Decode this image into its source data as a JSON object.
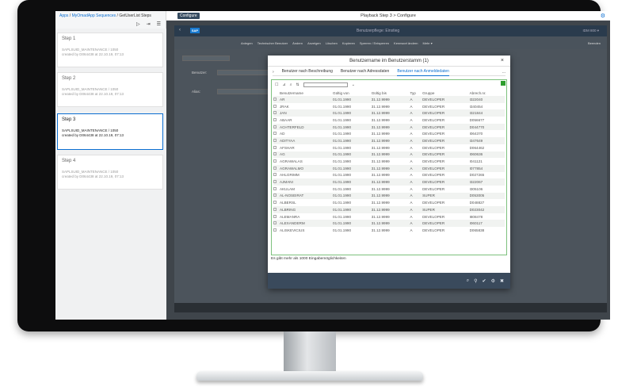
{
  "left": {
    "breadcrumb": {
      "apps": "Apps",
      "sequences": "MyOmadApp Sequences",
      "current": "GetUserList Steps"
    },
    "icons": [
      "play-icon",
      "step-forward-icon",
      "list-icon"
    ],
    "steps": [
      {
        "title": "Step 1",
        "line1": "SAPLSUID_MAINTENANCE / 1050",
        "line2": "created by D064438 at 22.10.19, 07:13"
      },
      {
        "title": "Step 2",
        "line1": "SAPLSUID_MAINTENANCE / 1050",
        "line2": "created by D064438 at 22.10.19, 07:13"
      },
      {
        "title": "Step 3",
        "line1": "SAPLSUID_MAINTENANCE / 1050",
        "line2": "created by D064438 at 22.10.19, 07:13"
      },
      {
        "title": "Step 4",
        "line1": "SAPLSUID_MAINTENANCE / 1050",
        "line2": "created by D064438 at 22.10.19, 07:13"
      }
    ]
  },
  "topbar": {
    "configure": "Configure",
    "title": "Playback Step 3 > Configure"
  },
  "sap": {
    "logo": "SAP",
    "header_title": "Benutzerpflege: Einstieg",
    "header_right": "IDM 800 ▾",
    "toolbar": [
      "Anlegen",
      "Technischer Benutzer",
      "Ändern",
      "Anzeigen",
      "Löschen",
      "Kopieren",
      "Sperren / Entsperren",
      "Kennwort ändern",
      "Mehr ▾"
    ],
    "toolbar_right": "Beenden",
    "fields": [
      "Benutzer:",
      "Alias:"
    ]
  },
  "dialog": {
    "title": "Benutzername im Benutzerstamm (1)",
    "tabs": [
      "Benutzer nach Beschreibung",
      "Benutzer nach Adressdaten",
      "Benutzer nach Anmeldedaten"
    ],
    "more": "...",
    "columns": [
      "Benutzername",
      "Gültig von",
      "Gültig bis",
      "Typ",
      "Gruppe",
      "Abrech.nr."
    ],
    "rows": [
      [
        "AR",
        "01.01.1990",
        "31.12.9999",
        "A",
        "DEVELOPER",
        "I322040"
      ],
      [
        "JRAK",
        "01.01.1990",
        "31.12.9999",
        "A",
        "DEVELOPER",
        "I340454"
      ],
      [
        "JAN",
        "01.01.1990",
        "31.12.9999",
        "A",
        "DEVELOPER",
        "I321844"
      ],
      [
        "ABAAR",
        "01.01.1990",
        "31.12.9999",
        "A",
        "DEVELOPER",
        "D056677"
      ],
      [
        "ACHTERFELD",
        "01.01.1990",
        "31.12.9999",
        "A",
        "DEVELOPER",
        "D044770"
      ],
      [
        "AD",
        "01.01.1990",
        "31.12.9999",
        "A",
        "DEVELOPER",
        "I064370"
      ],
      [
        "ADITYAA",
        "01.01.1990",
        "31.12.9999",
        "A",
        "DEVELOPER",
        "I347649"
      ],
      [
        "AFSHAR",
        "01.01.1990",
        "31.12.9999",
        "A",
        "DEVELOPER",
        "D064462"
      ],
      [
        "AG",
        "01.01.1990",
        "31.12.9999",
        "A",
        "DEVELOPER",
        "I060636"
      ],
      [
        "AGRAWALAS",
        "01.01.1990",
        "31.12.9999",
        "A",
        "DEVELOPER",
        "I041121"
      ],
      [
        "AGRAWALMO",
        "01.01.1990",
        "31.12.9999",
        "A",
        "DEVELOPER",
        "I077854"
      ],
      [
        "AHLGRIMM",
        "01.01.1990",
        "31.12.9999",
        "A",
        "DEVELOPER",
        "D027265"
      ],
      [
        "AJMANI",
        "01.01.1990",
        "31.12.9999",
        "A",
        "DEVELOPER",
        "I322067"
      ],
      [
        "AKULAM",
        "01.01.1990",
        "31.12.9999",
        "A",
        "DEVELOPER",
        "I305106"
      ],
      [
        "AL-NOSEIRAT",
        "01.01.1990",
        "31.12.9999",
        "A",
        "SUPER",
        "D053005"
      ],
      [
        "ALBERSL",
        "01.01.1990",
        "31.12.9999",
        "A",
        "DEVELOPER",
        "D048827"
      ],
      [
        "ALBRING",
        "01.01.1990",
        "31.12.9999",
        "A",
        "SUPER",
        "D023042"
      ],
      [
        "ALEMANRA",
        "01.01.1990",
        "31.12.9999",
        "A",
        "DEVELOPER",
        "I808478"
      ],
      [
        "ALEXANDERM",
        "01.01.1990",
        "31.12.9999",
        "A",
        "DEVELOPER",
        "I060117"
      ],
      [
        "ALISKEVICIUS",
        "01.01.1990",
        "31.12.9999",
        "A",
        "DEVELOPER",
        "D065838"
      ]
    ],
    "note": "Es gibt mehr als 1000 Eingabemöglichkeiten",
    "footer_icons": [
      "search-icon",
      "filter-icon",
      "check-icon",
      "settings-icon",
      "close-icon"
    ]
  }
}
